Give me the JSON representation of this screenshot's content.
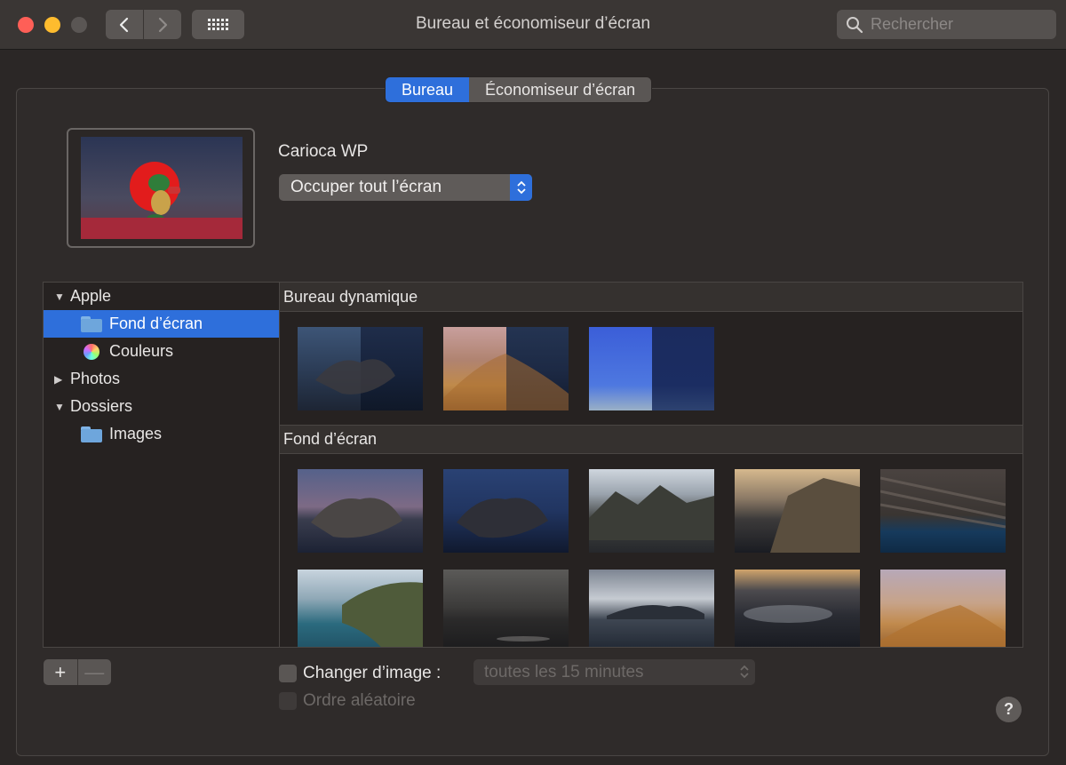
{
  "window": {
    "title": "Bureau et économiseur d’écran",
    "search_placeholder": "Rechercher"
  },
  "tabs": [
    {
      "label": "Bureau",
      "active": true
    },
    {
      "label": "Économiseur d’écran",
      "active": false
    }
  ],
  "current_wallpaper": {
    "name": "Carioca WP",
    "fit_option": "Occuper tout l’écran"
  },
  "sources": [
    {
      "label": "Apple",
      "type": "group",
      "expanded": true
    },
    {
      "label": "Fond d’écran",
      "type": "folder",
      "selected": true
    },
    {
      "label": "Couleurs",
      "type": "colors",
      "selected": false
    },
    {
      "label": "Photos",
      "type": "group",
      "expanded": false
    },
    {
      "label": "Dossiers",
      "type": "group",
      "expanded": true
    },
    {
      "label": "Images",
      "type": "folder",
      "selected": false
    }
  ],
  "sections": {
    "dynamic": "Bureau dynamique",
    "wallpapers": "Fond d’écran"
  },
  "thumbnails": {
    "dynamic": [
      "catalina-dynamic",
      "mojave-dynamic",
      "solar-gradient-dynamic"
    ],
    "wallpapers": [
      "catalina-day",
      "catalina-evening",
      "mountain-coast",
      "cliff-sunset",
      "rock-layers",
      "coastline",
      "storm-sea",
      "island-clouds",
      "misty-islands",
      "mojave-dunes"
    ]
  },
  "bottom": {
    "add_label": "+",
    "remove_label": "—",
    "change_picture_label": "Changer d’image :",
    "interval_value": "toutes les 15 minutes",
    "random_order_label": "Ordre aléatoire",
    "help_label": "?"
  },
  "colors": {
    "accent": "#2e6fdb",
    "close": "#fe5f57",
    "minimize": "#febc2e"
  }
}
